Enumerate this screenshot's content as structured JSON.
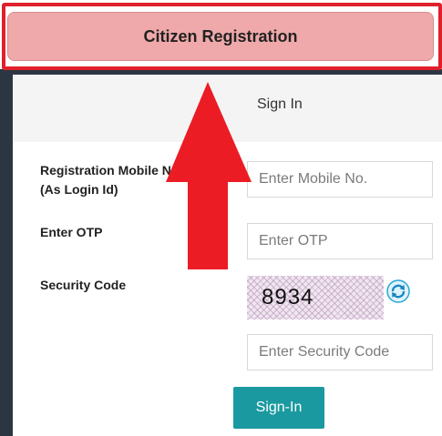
{
  "header": {
    "citizen_registration_label": "Citizen Registration"
  },
  "tabs": {
    "sign_in_label": "Sign In"
  },
  "form": {
    "mobile_label_line1": "Registration Mobile No.",
    "mobile_label_line2": "(As Login Id)",
    "mobile_placeholder": "Enter Mobile No.",
    "mobile_value": "",
    "otp_label": "Enter OTP",
    "otp_placeholder": "Enter OTP",
    "otp_value": "",
    "security_code_label": "Security Code",
    "captcha_text": "8934",
    "security_code_placeholder": "Enter Security Code",
    "security_code_value": "",
    "submit_label": "Sign-In"
  },
  "icons": {
    "refresh": "refresh-icon",
    "arrow": "arrow-up-icon"
  },
  "colors": {
    "highlight_border": "#e0202a",
    "registration_button": "#f0a9aa",
    "submit_button": "#1a9aa0",
    "arrow": "#ec1c24"
  }
}
